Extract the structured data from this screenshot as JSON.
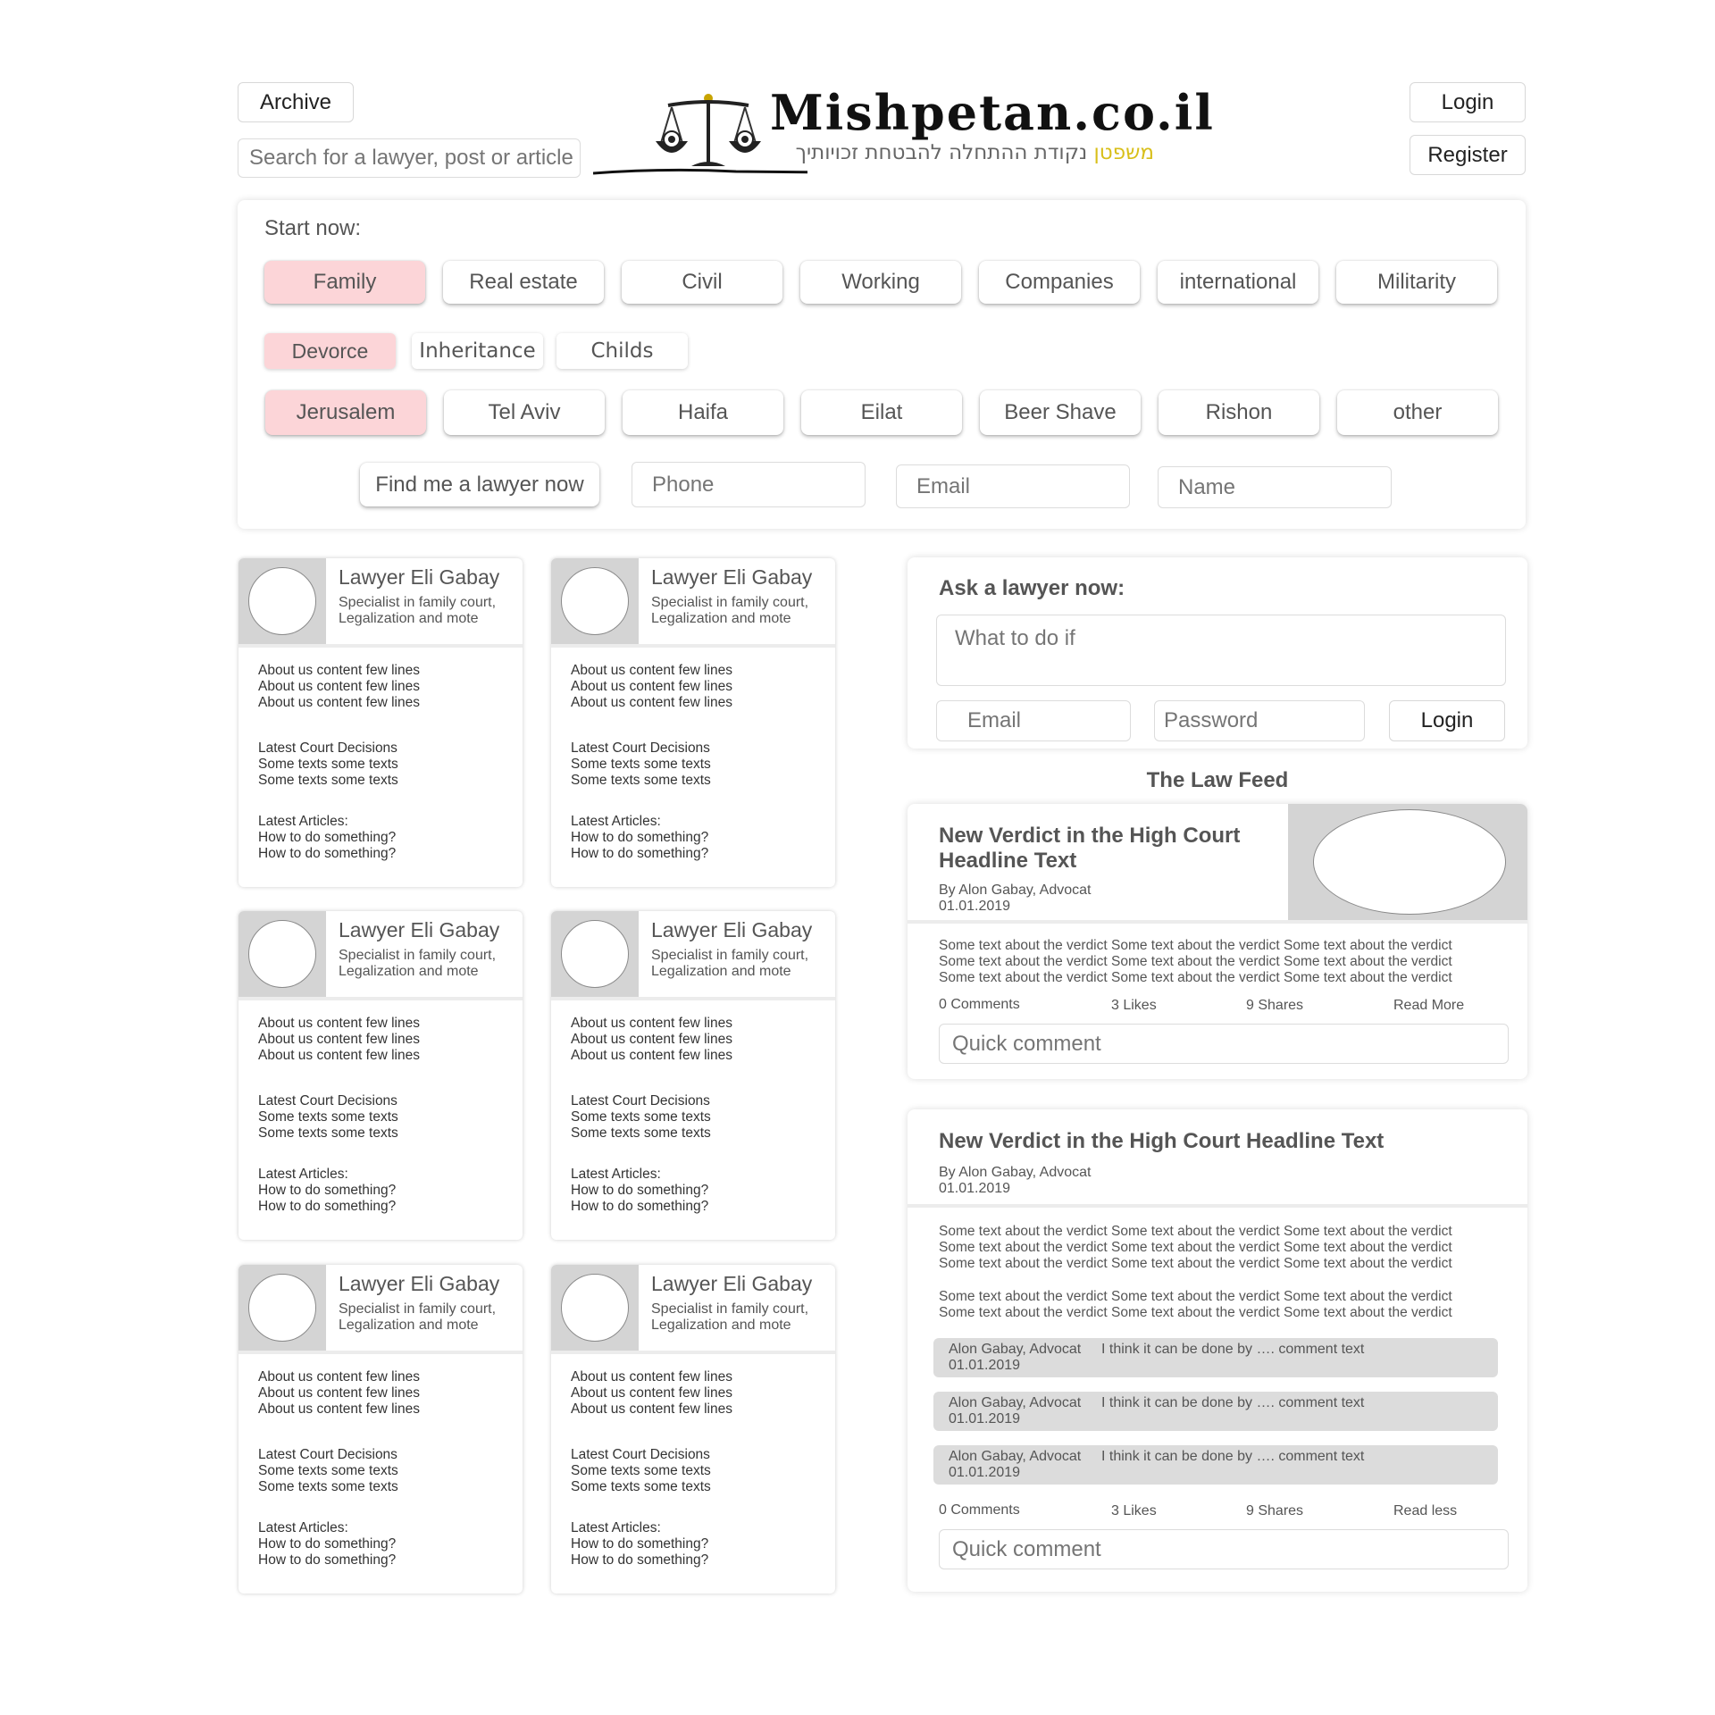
{
  "header": {
    "archive_label": "Archive",
    "search_placeholder": "Search for a lawyer, post or article",
    "logo_title": "Mishpetan.co.il",
    "logo_tagline_brand": "משפטן",
    "logo_tagline_rest": "נקודת ההתחלה להבטחת זכויותיך",
    "login_label": "Login",
    "register_label": "Register"
  },
  "start_panel": {
    "heading": "Start now:",
    "categories": [
      {
        "label": "Family",
        "selected": true
      },
      {
        "label": "Real estate",
        "selected": false
      },
      {
        "label": "Civil",
        "selected": false
      },
      {
        "label": "Working",
        "selected": false
      },
      {
        "label": "Companies",
        "selected": false
      },
      {
        "label": "international",
        "selected": false
      },
      {
        "label": "Militarity",
        "selected": false
      }
    ],
    "subcategories": [
      {
        "label": "Devorce",
        "selected": true
      },
      {
        "label": "Inheritance",
        "selected": false
      },
      {
        "label": "Childs",
        "selected": false
      }
    ],
    "cities": [
      {
        "label": "Jerusalem",
        "selected": true
      },
      {
        "label": "Tel Aviv",
        "selected": false
      },
      {
        "label": "Haifa",
        "selected": false
      },
      {
        "label": "Eilat",
        "selected": false
      },
      {
        "label": "Beer Shave",
        "selected": false
      },
      {
        "label": "Rishon",
        "selected": false
      },
      {
        "label": "other",
        "selected": false
      }
    ],
    "find_button": "Find me a lawyer now",
    "phone_placeholder": "Phone",
    "email_placeholder": "Email",
    "name_placeholder": "Name",
    "selected_color": "#fcd5d8"
  },
  "lawyer_cards": [
    {
      "name": "Lawyer Eli Gabay",
      "spec1": "Specialist in family court,",
      "spec2": "Legalization and mote",
      "about": [
        "About us content few lines",
        "About us content few lines",
        "About us content few lines"
      ],
      "decisions": [
        "Latest Court Decisions",
        "Some texts some texts",
        "Some texts some texts"
      ],
      "articles": [
        "Latest Articles:",
        "How to do something?",
        "How to do something?"
      ]
    },
    {
      "name": "Lawyer Eli Gabay",
      "spec1": "Specialist in family court,",
      "spec2": "Legalization and mote",
      "about": [
        "About us content few lines",
        "About us content few lines",
        "About us content few lines"
      ],
      "decisions": [
        "Latest Court Decisions",
        "Some texts some texts",
        "Some texts some texts"
      ],
      "articles": [
        "Latest Articles:",
        "How to do something?",
        "How to do something?"
      ]
    },
    {
      "name": "Lawyer Eli Gabay",
      "spec1": "Specialist in family court,",
      "spec2": "Legalization and mote",
      "about": [
        "About us content few lines",
        "About us content few lines",
        "About us content few lines"
      ],
      "decisions": [
        "Latest Court Decisions",
        "Some texts some texts",
        "Some texts some texts"
      ],
      "articles": [
        "Latest Articles:",
        "How to do something?",
        "How to do something?"
      ]
    },
    {
      "name": "Lawyer Eli Gabay",
      "spec1": "Specialist in family court,",
      "spec2": "Legalization and mote",
      "about": [
        "About us content few lines",
        "About us content few lines",
        "About us content few lines"
      ],
      "decisions": [
        "Latest Court Decisions",
        "Some texts some texts",
        "Some texts some texts"
      ],
      "articles": [
        "Latest Articles:",
        "How to do something?",
        "How to do something?"
      ]
    },
    {
      "name": "Lawyer Eli Gabay",
      "spec1": "Specialist in family court,",
      "spec2": "Legalization and mote",
      "about": [
        "About us content few lines",
        "About us content few lines",
        "About us content few lines"
      ],
      "decisions": [
        "Latest Court Decisions",
        "Some texts some texts",
        "Some texts some texts"
      ],
      "articles": [
        "Latest Articles:",
        "How to do something?",
        "How to do something?"
      ]
    },
    {
      "name": "Lawyer Eli Gabay",
      "spec1": "Specialist in family court,",
      "spec2": "Legalization and mote",
      "about": [
        "About us content few lines",
        "About us content few lines",
        "About us content few lines"
      ],
      "decisions": [
        "Latest Court Decisions",
        "Some texts some texts",
        "Some texts some texts"
      ],
      "articles": [
        "Latest Articles:",
        "How to do something?",
        "How to do something?"
      ]
    }
  ],
  "ask_panel": {
    "heading": "Ask a lawyer now:",
    "question_placeholder": "What to do if",
    "email_placeholder": "Email",
    "password_placeholder": "Password",
    "login_label": "Login"
  },
  "feed": {
    "title": "The Law Feed",
    "post1": {
      "headline_line1": "New Verdict in the High Court",
      "headline_line2": "Headline Text",
      "author": "By Alon Gabay, Advocat",
      "date": "01.01.2019",
      "body": [
        "Some text about the verdict Some text about the verdict Some text about the verdict",
        "Some text about the verdict Some text about the verdict Some text about the verdict",
        "Some text about the verdict Some text about the verdict Some text about the verdict"
      ],
      "comments": "0 Comments",
      "likes": "3 Likes",
      "shares": "9 Shares",
      "read": "Read More",
      "comment_placeholder": "Quick comment"
    },
    "post2": {
      "headline": "New Verdict in the High Court Headline Text",
      "author": "By Alon Gabay, Advocat",
      "date": "01.01.2019",
      "body": [
        "Some text about the verdict Some text about the verdict Some text about the verdict",
        "Some text about the verdict Some text about the verdict Some text about the verdict",
        "Some text about the verdict Some text about the verdict Some text about the verdict"
      ],
      "body2": [
        "Some text about the verdict Some text about the verdict Some text about the verdict",
        "Some text about the verdict Some text about the verdict Some text about the verdict"
      ],
      "comment_list": [
        {
          "author": "Alon Gabay, Advocat",
          "date": "01.01.2019",
          "text": "I think it can be done by …. comment text"
        },
        {
          "author": "Alon Gabay, Advocat",
          "date": "01.01.2019",
          "text": "I think it can be done by …. comment text"
        },
        {
          "author": "Alon Gabay, Advocat",
          "date": "01.01.2019",
          "text": "I think it can be done by …. comment text"
        }
      ],
      "comments": "0 Comments",
      "likes": "3 Likes",
      "shares": "9 Shares",
      "read": "Read less",
      "comment_placeholder": "Quick comment"
    }
  }
}
